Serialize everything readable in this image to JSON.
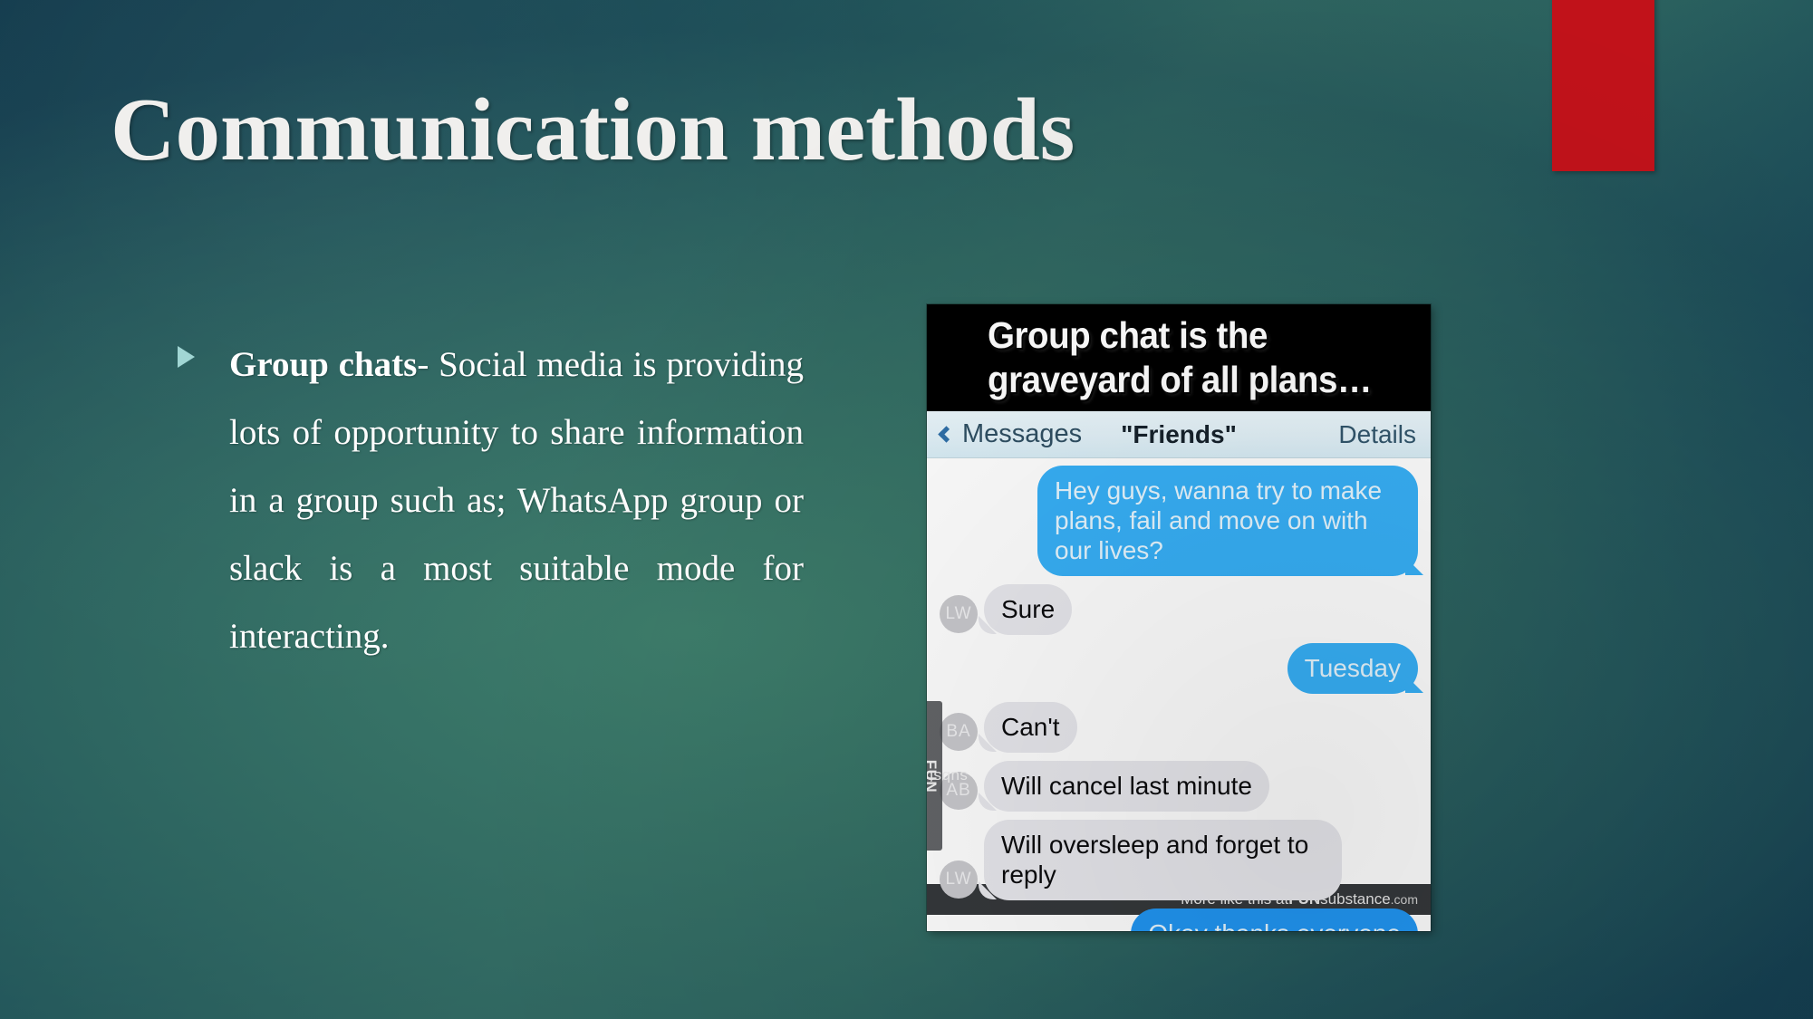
{
  "slide": {
    "title": "Communication methods",
    "accent_color": "#c1121a",
    "bullet_marker_color": "#9fd5d3",
    "background_colors": [
      "#123a4c",
      "#336b62",
      "#1a4a58"
    ]
  },
  "body": {
    "bullet_lead": "Group chats",
    "bullet_rest": "- Social media is providing lots of opportunity to share information in a group such as; WhatsApp group or slack is a most suitable mode for interacting."
  },
  "meme": {
    "caption_line1": "Group chat is the",
    "caption_line2": "graveyard of all plans…",
    "nav": {
      "back_label": "Messages",
      "title": "\"Friends\"",
      "details_label": "Details"
    },
    "messages": [
      {
        "side": "out",
        "text": "Hey guys, wanna try to make plans, fail and move on with our lives?",
        "avatar": ""
      },
      {
        "side": "in",
        "text": "Sure",
        "avatar": "LW"
      },
      {
        "side": "out",
        "text": "Tuesday",
        "avatar": ""
      },
      {
        "side": "in",
        "text": "Can't",
        "avatar": "BA"
      },
      {
        "side": "in",
        "text": "Will cancel last minute",
        "avatar": "AB"
      },
      {
        "side": "in",
        "text": "Will oversleep and forget to reply",
        "avatar": "LW"
      },
      {
        "side": "out",
        "text": "Okay thanks everyone",
        "avatar": ""
      }
    ],
    "watermark": {
      "prefix": "FUN",
      "suffix": "substance"
    },
    "footer": {
      "text": "More like this at ",
      "brand_bold": "FUN",
      "brand_rest": "substance",
      "tld": ".com"
    },
    "bubble_colors": {
      "incoming": "#e8e8ed",
      "outgoing": "#37b0f7"
    }
  }
}
